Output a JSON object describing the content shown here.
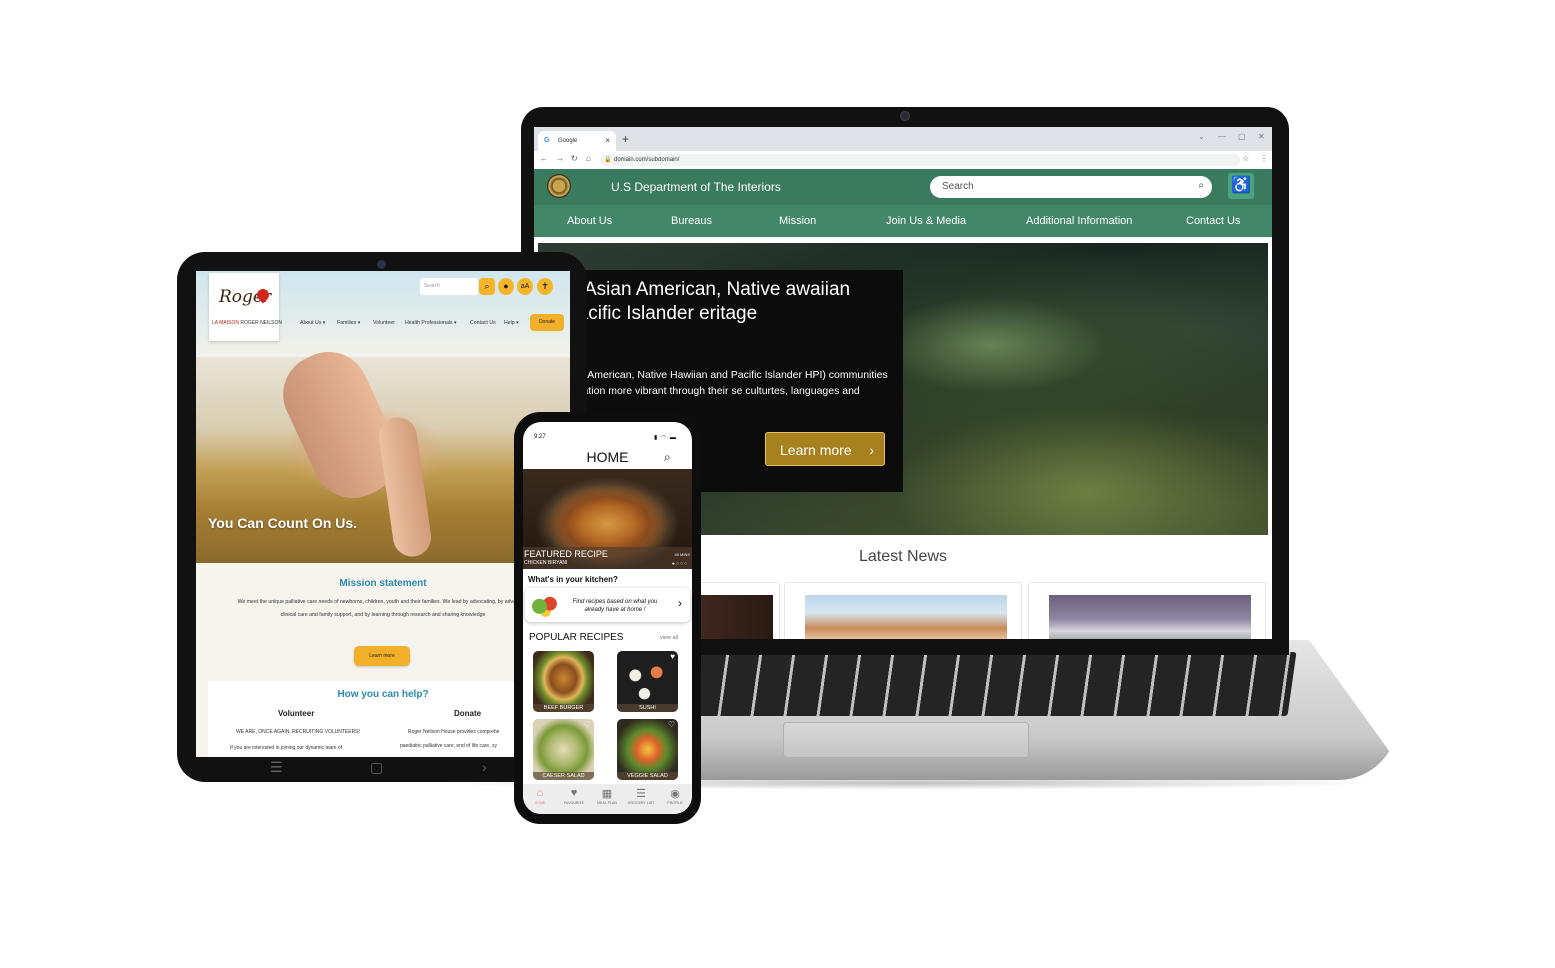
{
  "laptop": {
    "browser": {
      "tab_label": "Google",
      "url": "domain.com/subdomain/"
    },
    "site": {
      "title": "U.S Department of The Interiors",
      "search_placeholder": "Search",
      "nav": [
        "About Us",
        "Bureaus",
        "Mission",
        "Join Us & Media",
        "Additional Information",
        "Contact Us"
      ],
      "hero_title": "xplore Asian American, Native awaiian and Pacific Islander eritage",
      "hero_desc": "Asian North American, Native Hawiian and Pacific Islander HPI) communities make our nation more vibrant through their se culturtes, languages and religions",
      "hero_button": "Learn more",
      "latest_news": "Latest News"
    },
    "colors": {
      "header": "#3a7a5f",
      "nav": "#43876a",
      "button": "#a7811e"
    }
  },
  "tablet": {
    "logo_script": "Roger",
    "logo_caption_a": "LA MAISON",
    "logo_caption_b": "ROGER NEILSON",
    "search_placeholder": "Search",
    "nav": [
      "About Us ▾",
      "Families ▾",
      "Volunteer",
      "Health Professionals ▾",
      "Contact Us",
      "Help ▾"
    ],
    "donate": "Donate",
    "hero_text": "You Can Count On Us.",
    "mission_title": "Mission statement",
    "mission_text": "We meet the unique palliative care needs of newborns, children, youth and their families. We lead by advocating, by advancing clinical care and family support, and by learning through research and sharing knowledge",
    "learn_more": "Learn more",
    "help_title": "How you can help?",
    "volunteer_title": "Volunteer",
    "volunteer_line1": "WE ARE, ONCE AGAIN, RECRUITING VOLUNTEERS!",
    "volunteer_line2": "If you are interested in joining our dynamic team of",
    "donate_title": "Donate",
    "donate_line1": "Roger Neilson House provides comprehe",
    "donate_line2": "paediatric palliative care, end of life care, sy"
  },
  "phone": {
    "time": "9:27",
    "title": "HOME",
    "featured_label": "FEATURED RECIPE",
    "featured_name": "CHICKEN BIRYANI",
    "featured_time": "45 MINS",
    "kitchen_title": "What's in your kitchen?",
    "kitchen_text": "Find recipes based on what you already have at home !",
    "popular_title": "POPULAR RECIPES",
    "view_all": "view all",
    "recipes": [
      "BEEF BURGER",
      "SUSHI",
      "CAESER SALAD",
      "VEGGIE SALAD"
    ],
    "tabs": [
      "HOME",
      "FAVOURITE",
      "MEAL PLAN",
      "GROCERY LIST",
      "PROFILE"
    ]
  }
}
